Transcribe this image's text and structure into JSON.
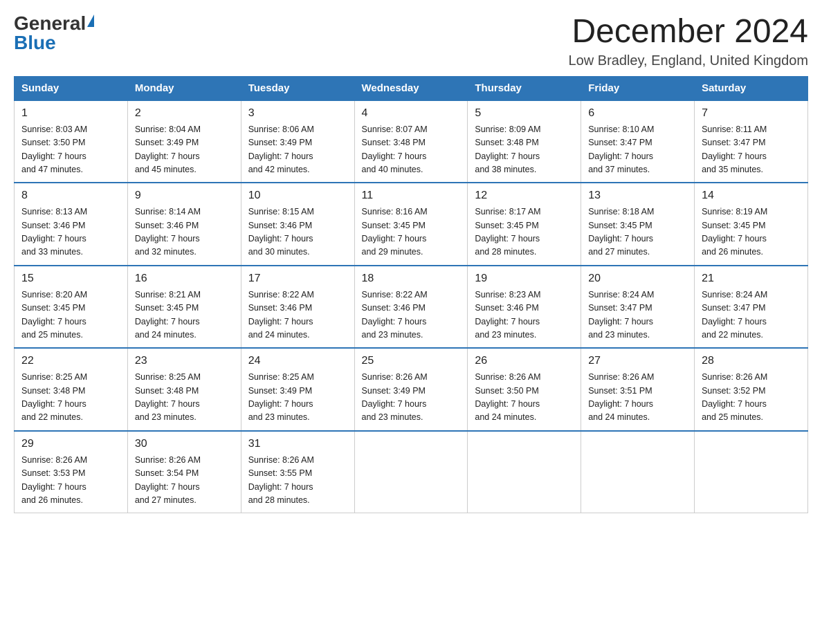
{
  "logo": {
    "general": "General",
    "blue": "Blue"
  },
  "header": {
    "title": "December 2024",
    "location": "Low Bradley, England, United Kingdom"
  },
  "days_of_week": [
    "Sunday",
    "Monday",
    "Tuesday",
    "Wednesday",
    "Thursday",
    "Friday",
    "Saturday"
  ],
  "weeks": [
    [
      {
        "day": "1",
        "sunrise": "8:03 AM",
        "sunset": "3:50 PM",
        "daylight": "7 hours and 47 minutes."
      },
      {
        "day": "2",
        "sunrise": "8:04 AM",
        "sunset": "3:49 PM",
        "daylight": "7 hours and 45 minutes."
      },
      {
        "day": "3",
        "sunrise": "8:06 AM",
        "sunset": "3:49 PM",
        "daylight": "7 hours and 42 minutes."
      },
      {
        "day": "4",
        "sunrise": "8:07 AM",
        "sunset": "3:48 PM",
        "daylight": "7 hours and 40 minutes."
      },
      {
        "day": "5",
        "sunrise": "8:09 AM",
        "sunset": "3:48 PM",
        "daylight": "7 hours and 38 minutes."
      },
      {
        "day": "6",
        "sunrise": "8:10 AM",
        "sunset": "3:47 PM",
        "daylight": "7 hours and 37 minutes."
      },
      {
        "day": "7",
        "sunrise": "8:11 AM",
        "sunset": "3:47 PM",
        "daylight": "7 hours and 35 minutes."
      }
    ],
    [
      {
        "day": "8",
        "sunrise": "8:13 AM",
        "sunset": "3:46 PM",
        "daylight": "7 hours and 33 minutes."
      },
      {
        "day": "9",
        "sunrise": "8:14 AM",
        "sunset": "3:46 PM",
        "daylight": "7 hours and 32 minutes."
      },
      {
        "day": "10",
        "sunrise": "8:15 AM",
        "sunset": "3:46 PM",
        "daylight": "7 hours and 30 minutes."
      },
      {
        "day": "11",
        "sunrise": "8:16 AM",
        "sunset": "3:45 PM",
        "daylight": "7 hours and 29 minutes."
      },
      {
        "day": "12",
        "sunrise": "8:17 AM",
        "sunset": "3:45 PM",
        "daylight": "7 hours and 28 minutes."
      },
      {
        "day": "13",
        "sunrise": "8:18 AM",
        "sunset": "3:45 PM",
        "daylight": "7 hours and 27 minutes."
      },
      {
        "day": "14",
        "sunrise": "8:19 AM",
        "sunset": "3:45 PM",
        "daylight": "7 hours and 26 minutes."
      }
    ],
    [
      {
        "day": "15",
        "sunrise": "8:20 AM",
        "sunset": "3:45 PM",
        "daylight": "7 hours and 25 minutes."
      },
      {
        "day": "16",
        "sunrise": "8:21 AM",
        "sunset": "3:45 PM",
        "daylight": "7 hours and 24 minutes."
      },
      {
        "day": "17",
        "sunrise": "8:22 AM",
        "sunset": "3:46 PM",
        "daylight": "7 hours and 24 minutes."
      },
      {
        "day": "18",
        "sunrise": "8:22 AM",
        "sunset": "3:46 PM",
        "daylight": "7 hours and 23 minutes."
      },
      {
        "day": "19",
        "sunrise": "8:23 AM",
        "sunset": "3:46 PM",
        "daylight": "7 hours and 23 minutes."
      },
      {
        "day": "20",
        "sunrise": "8:24 AM",
        "sunset": "3:47 PM",
        "daylight": "7 hours and 23 minutes."
      },
      {
        "day": "21",
        "sunrise": "8:24 AM",
        "sunset": "3:47 PM",
        "daylight": "7 hours and 22 minutes."
      }
    ],
    [
      {
        "day": "22",
        "sunrise": "8:25 AM",
        "sunset": "3:48 PM",
        "daylight": "7 hours and 22 minutes."
      },
      {
        "day": "23",
        "sunrise": "8:25 AM",
        "sunset": "3:48 PM",
        "daylight": "7 hours and 23 minutes."
      },
      {
        "day": "24",
        "sunrise": "8:25 AM",
        "sunset": "3:49 PM",
        "daylight": "7 hours and 23 minutes."
      },
      {
        "day": "25",
        "sunrise": "8:26 AM",
        "sunset": "3:49 PM",
        "daylight": "7 hours and 23 minutes."
      },
      {
        "day": "26",
        "sunrise": "8:26 AM",
        "sunset": "3:50 PM",
        "daylight": "7 hours and 24 minutes."
      },
      {
        "day": "27",
        "sunrise": "8:26 AM",
        "sunset": "3:51 PM",
        "daylight": "7 hours and 24 minutes."
      },
      {
        "day": "28",
        "sunrise": "8:26 AM",
        "sunset": "3:52 PM",
        "daylight": "7 hours and 25 minutes."
      }
    ],
    [
      {
        "day": "29",
        "sunrise": "8:26 AM",
        "sunset": "3:53 PM",
        "daylight": "7 hours and 26 minutes."
      },
      {
        "day": "30",
        "sunrise": "8:26 AM",
        "sunset": "3:54 PM",
        "daylight": "7 hours and 27 minutes."
      },
      {
        "day": "31",
        "sunrise": "8:26 AM",
        "sunset": "3:55 PM",
        "daylight": "7 hours and 28 minutes."
      },
      null,
      null,
      null,
      null
    ]
  ]
}
